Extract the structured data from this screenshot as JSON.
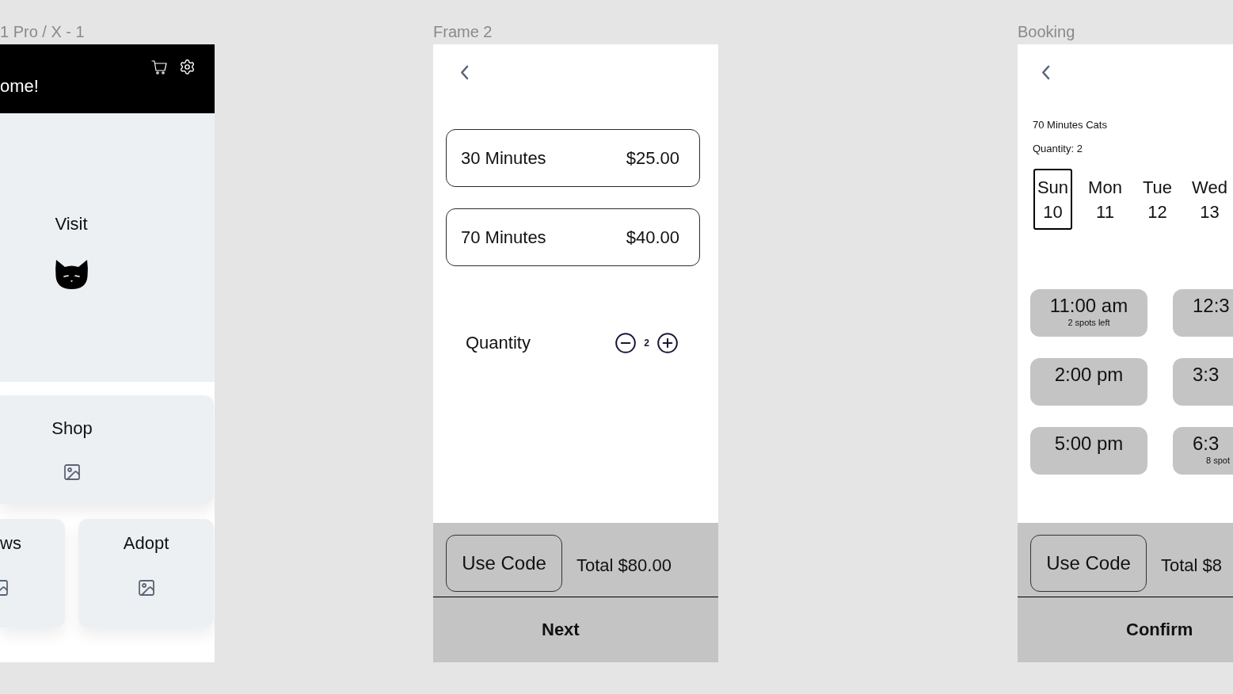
{
  "home_frame": {
    "label": "1 Pro / X - 1",
    "greeting": "ome!",
    "tiles": [
      {
        "kind": "hero",
        "label": "Visit"
      },
      {
        "kind": "wide",
        "label": "Shop"
      },
      {
        "kind": "small",
        "label": "ws"
      },
      {
        "kind": "small",
        "label": "Adopt"
      }
    ]
  },
  "option_frame": {
    "label": "Frame 2",
    "options": [
      {
        "name": "30 Minutes",
        "price": "$25.00"
      },
      {
        "name": "70 Minutes",
        "price": "$40.00"
      }
    ],
    "quantity": {
      "label": "Quantity",
      "value": "2"
    },
    "footer": {
      "code_button": "Use Code",
      "total": "Total $80.00",
      "action": "Next"
    }
  },
  "booking_frame": {
    "label": "Booking",
    "summary": [
      "70 Minutes Cats",
      "Quantity: 2"
    ],
    "days": [
      {
        "weekday": "Sun",
        "date": "10",
        "selected": true
      },
      {
        "weekday": "Mon",
        "date": "11",
        "selected": false
      },
      {
        "weekday": "Tue",
        "date": "12",
        "selected": false
      },
      {
        "weekday": "Wed",
        "date": "13",
        "selected": false
      }
    ],
    "slots": [
      {
        "time": "11:00 am",
        "note": "2 spots left"
      },
      {
        "time": "12:3"
      },
      {
        "time": "2:00 pm"
      },
      {
        "time": "3:3"
      },
      {
        "time": "5:00 pm"
      },
      {
        "time": "6:3",
        "note": "8 spot"
      }
    ],
    "footer": {
      "code_button": "Use Code",
      "total": "Total $8",
      "action": "Confirm"
    }
  }
}
